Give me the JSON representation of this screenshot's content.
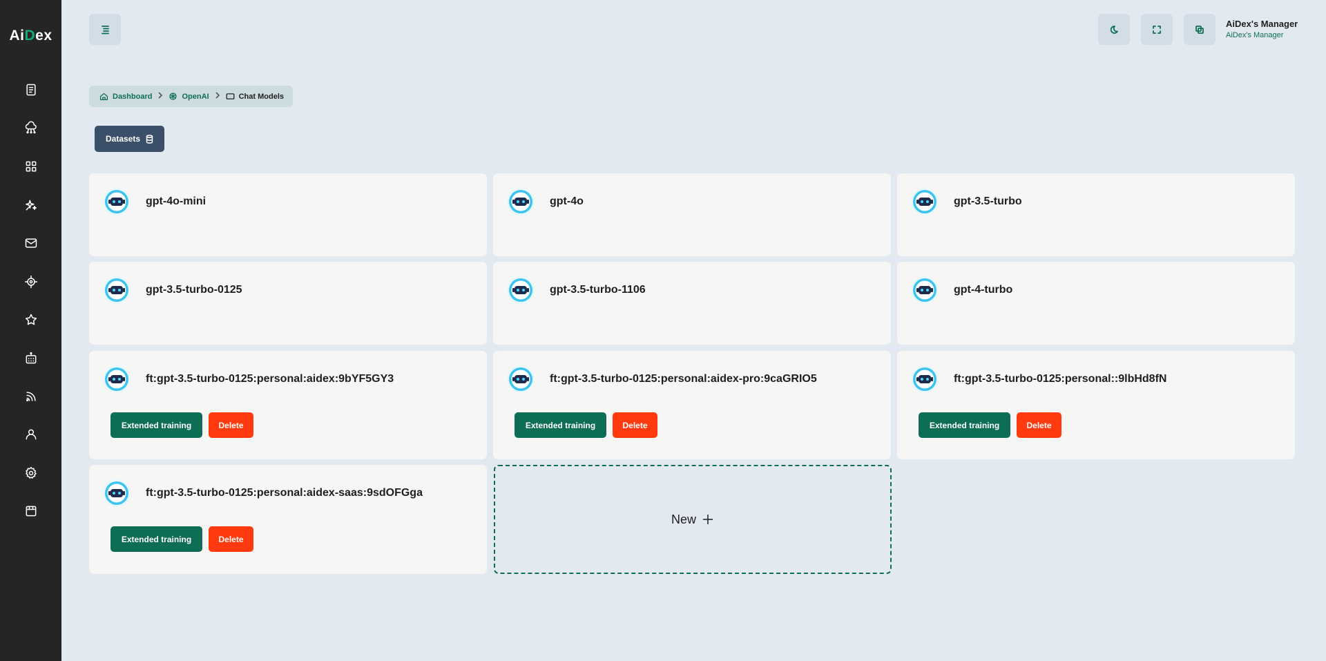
{
  "app": {
    "logo_pre": "Ai",
    "logo_accent": "D",
    "logo_post": "ex",
    "accent_color": "#0e6e55"
  },
  "sidebar": {
    "items": [
      {
        "icon": "document-icon"
      },
      {
        "icon": "cloud-network-icon"
      },
      {
        "icon": "grid-icon"
      },
      {
        "icon": "sparkle-icon"
      },
      {
        "icon": "mail-icon"
      },
      {
        "icon": "target-icon"
      },
      {
        "icon": "star-icon"
      },
      {
        "icon": "robot-calendar-icon"
      },
      {
        "icon": "rss-icon"
      },
      {
        "icon": "user-icon"
      },
      {
        "icon": "gear-icon"
      },
      {
        "icon": "box-icon"
      }
    ]
  },
  "header": {
    "user_name": "AiDex's Manager",
    "user_role": "AiDex's Manager"
  },
  "breadcrumb": {
    "items": [
      "Dashboard",
      "OpenAI",
      "Chat Models"
    ]
  },
  "datasets_button": {
    "label": "Datasets"
  },
  "models": [
    {
      "name": "gpt-4o-mini"
    },
    {
      "name": "gpt-4o"
    },
    {
      "name": "gpt-3.5-turbo"
    },
    {
      "name": "gpt-3.5-turbo-0125"
    },
    {
      "name": "gpt-3.5-turbo-1106"
    },
    {
      "name": "gpt-4-turbo"
    },
    {
      "name": "ft:gpt-3.5-turbo-0125:personal:aidex:9bYF5GY3"
    },
    {
      "name": "ft:gpt-3.5-turbo-0125:personal:aidex-pro:9caGRIO5"
    },
    {
      "name": "ft:gpt-3.5-turbo-0125:personal::9lbHd8fN"
    },
    {
      "name": "ft:gpt-3.5-turbo-0125:personal:aidex-saas:9sdOFGga"
    }
  ],
  "actions": {
    "extended_training": "Extended training",
    "delete": "Delete"
  },
  "new_card": {
    "label": "New"
  }
}
